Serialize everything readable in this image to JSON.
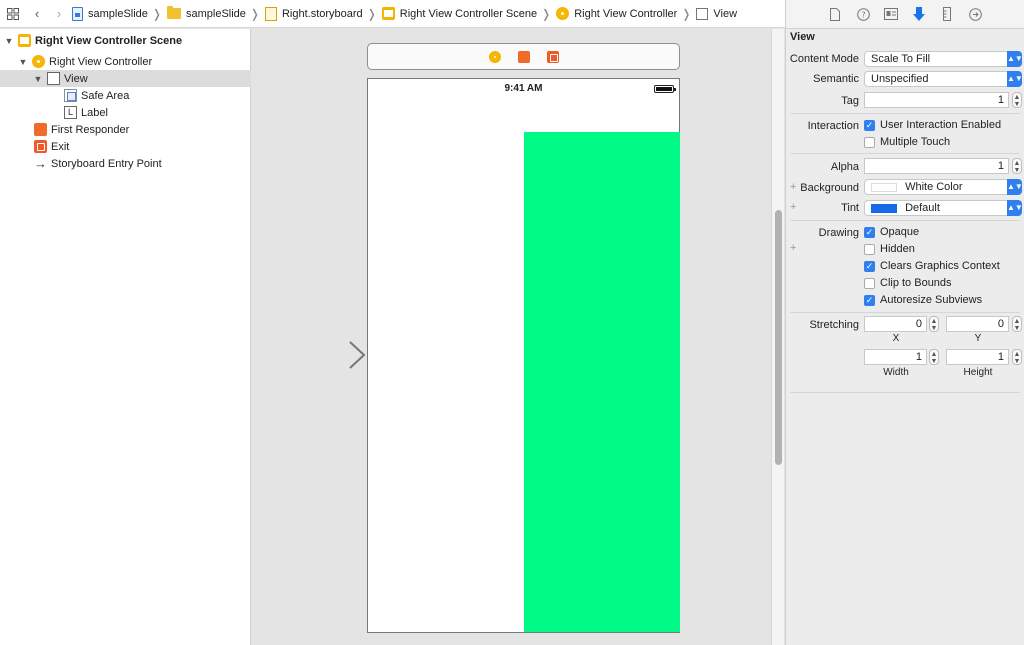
{
  "breadcrumb": [
    {
      "label": "sampleSlide",
      "icon": "file-icon"
    },
    {
      "label": "sampleSlide",
      "icon": "folder-icon"
    },
    {
      "label": "Right.storyboard",
      "icon": "storyboard-icon"
    },
    {
      "label": "Right View Controller Scene",
      "icon": "scene-icon"
    },
    {
      "label": "Right View Controller",
      "icon": "view-controller-icon"
    },
    {
      "label": "View",
      "icon": "view-icon"
    }
  ],
  "outline": {
    "scene": "Right View Controller Scene",
    "view_controller": "Right View Controller",
    "view": "View",
    "safe_area": "Safe Area",
    "label": "Label",
    "first_responder": "First Responder",
    "exit": "Exit",
    "entry_point": "Storyboard Entry Point",
    "label_glyph": "L"
  },
  "canvas": {
    "status_time": "9:41 AM",
    "green_color": "#00fa86"
  },
  "inspector": {
    "section_title": "View",
    "content_mode_label": "Content Mode",
    "content_mode_value": "Scale To Fill",
    "semantic_label": "Semantic",
    "semantic_value": "Unspecified",
    "tag_label": "Tag",
    "tag_value": "1",
    "interaction_label": "Interaction",
    "user_interaction": "User Interaction Enabled",
    "multiple_touch": "Multiple Touch",
    "alpha_label": "Alpha",
    "alpha_value": "1",
    "background_label": "Background",
    "background_value": "White Color",
    "tint_label": "Tint",
    "tint_value": "Default",
    "drawing_label": "Drawing",
    "opaque": "Opaque",
    "hidden": "Hidden",
    "clears_graphics": "Clears Graphics Context",
    "clip_to_bounds": "Clip to Bounds",
    "autoresize": "Autoresize Subviews",
    "stretching_label": "Stretching",
    "stretch_x": "0",
    "stretch_y": "0",
    "stretch_width": "1",
    "stretch_height": "1",
    "x_caption": "X",
    "y_caption": "Y",
    "width_caption": "Width",
    "height_caption": "Height",
    "tint_color": "#1769e8"
  }
}
